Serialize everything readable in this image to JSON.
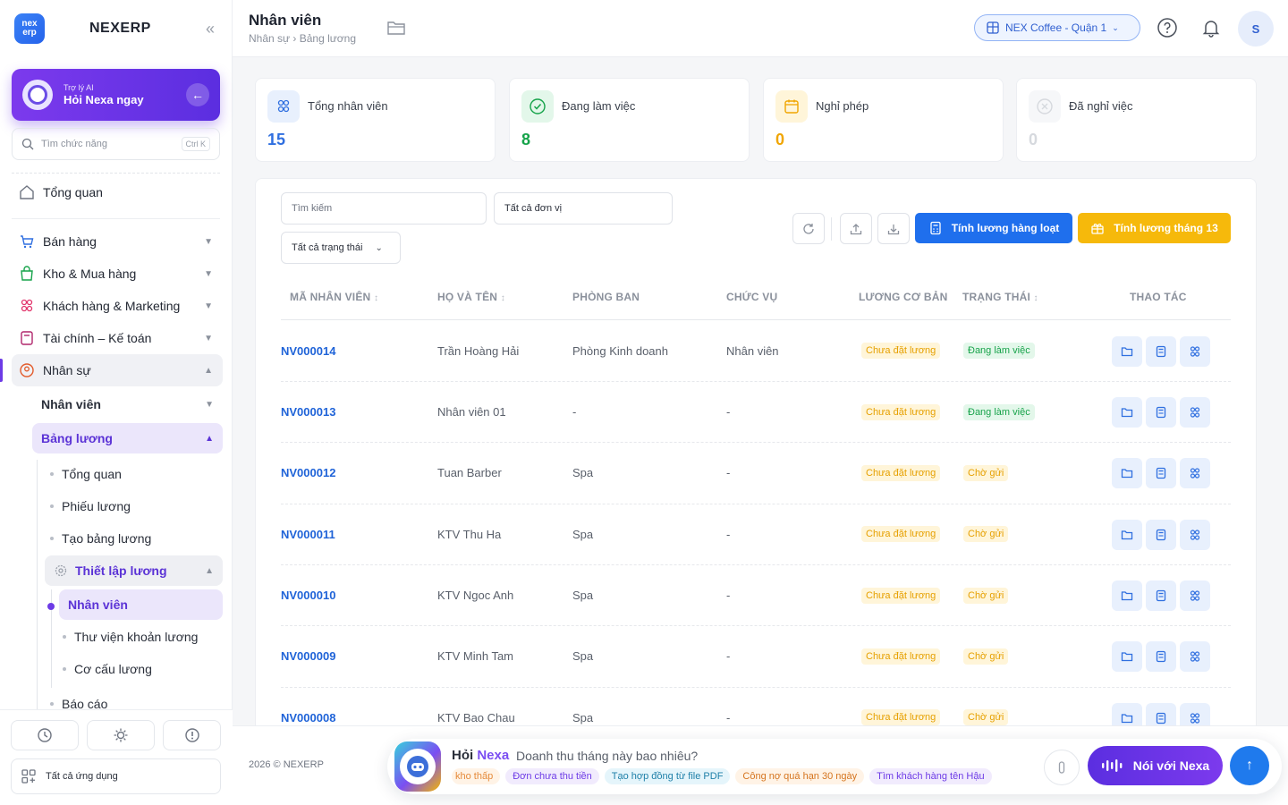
{
  "brand": {
    "name": "NEXERP",
    "logo_line1": "nex",
    "logo_line2": "erp"
  },
  "ai_card": {
    "subtitle": "Trợ lý AI",
    "title": "Hỏi Nexa ngay"
  },
  "side_search": {
    "placeholder": "Tìm chức năng",
    "shortcut": "Ctrl K"
  },
  "nav": {
    "overview": "Tổng quan",
    "sales": "Bán hàng",
    "warehouse": "Kho & Mua hàng",
    "customers": "Khách hàng & Marketing",
    "finance": "Tài chính – Kế toán",
    "hr": "Nhân sự"
  },
  "hr_sub": {
    "employees": "Nhân viên",
    "payroll": "Bảng lương",
    "payroll_items": [
      "Tổng quan",
      "Phiếu lương",
      "Tạo bảng lương"
    ],
    "setup": "Thiết lập lương",
    "setup_items": [
      "Nhân viên",
      "Thư viện khoản lương",
      "Cơ cấu lương"
    ],
    "report": "Báo cáo"
  },
  "all_apps": "Tất cả ứng dụng",
  "topbar": {
    "title": "Nhân viên",
    "breadcrumb": "Nhân sự › Bảng lương",
    "branch": "NEX Coffee - Quận 1",
    "avatar": "S"
  },
  "stats": [
    {
      "label": "Tổng nhân viên",
      "value": "15",
      "color": "#2f6fe0"
    },
    {
      "label": "Đang làm việc",
      "value": "8",
      "color": "#16a34a"
    },
    {
      "label": "Nghỉ phép",
      "value": "0",
      "color": "#f0a500"
    },
    {
      "label": "Đã nghỉ việc",
      "value": "0",
      "color": "#d6d9de"
    }
  ],
  "filters": {
    "search_placeholder": "Tìm kiếm",
    "unit_placeholder": "Tất cả đơn vị",
    "status_select": "Tất cả trạng thái"
  },
  "actions": {
    "batch_payroll": "Tính lương hàng loạt",
    "month13": "Tính lương tháng 13"
  },
  "table": {
    "headers": {
      "code": "MÃ NHÂN VIÊN",
      "name": "HỌ VÀ TÊN",
      "dept": "PHÒNG BAN",
      "position": "CHỨC VỤ",
      "salary": "LƯƠNG CƠ BẢN",
      "status": "TRẠNG THÁI",
      "actions": "THAO TÁC"
    },
    "rows": [
      {
        "code": "NV000014",
        "name": "Trần Hoàng Hải",
        "dept": "Phòng Kinh doanh",
        "position": "Nhân viên",
        "salary": "Chưa đặt lương",
        "status": "Đang làm việc"
      },
      {
        "code": "NV000013",
        "name": "Nhân viên 01",
        "dept": "-",
        "position": "-",
        "salary": "Chưa đặt lương",
        "status": "Đang làm việc"
      },
      {
        "code": "NV000012",
        "name": "Tuan Barber",
        "dept": "Spa",
        "position": "-",
        "salary": "Chưa đặt lương",
        "status": "Chờ gửi"
      },
      {
        "code": "NV000011",
        "name": "KTV Thu Ha",
        "dept": "Spa",
        "position": "-",
        "salary": "Chưa đặt lương",
        "status": "Chờ gửi"
      },
      {
        "code": "NV000010",
        "name": "KTV Ngoc Anh",
        "dept": "Spa",
        "position": "-",
        "salary": "Chưa đặt lương",
        "status": "Chờ gửi"
      },
      {
        "code": "NV000009",
        "name": "KTV Minh Tam",
        "dept": "Spa",
        "position": "-",
        "salary": "Chưa đặt lương",
        "status": "Chờ gửi"
      },
      {
        "code": "NV000008",
        "name": "KTV Bao Chau",
        "dept": "Spa",
        "position": "-",
        "salary": "Chưa đặt lương",
        "status": "Chờ gửi"
      }
    ]
  },
  "footer": {
    "copyright": "2026 © NEXERP"
  },
  "ask": {
    "title_a": "Hỏi ",
    "title_b": "Nexa",
    "question": "Doanh thu tháng này bao nhiêu?",
    "chips": [
      "kho thấp",
      "Đơn chưa thu tiền",
      "Tạo hợp đồng từ file PDF",
      "Công nợ quá hạn 30 ngày",
      "Tìm khách hàng tên Hậu"
    ],
    "talk": "Nói với Nexa"
  }
}
